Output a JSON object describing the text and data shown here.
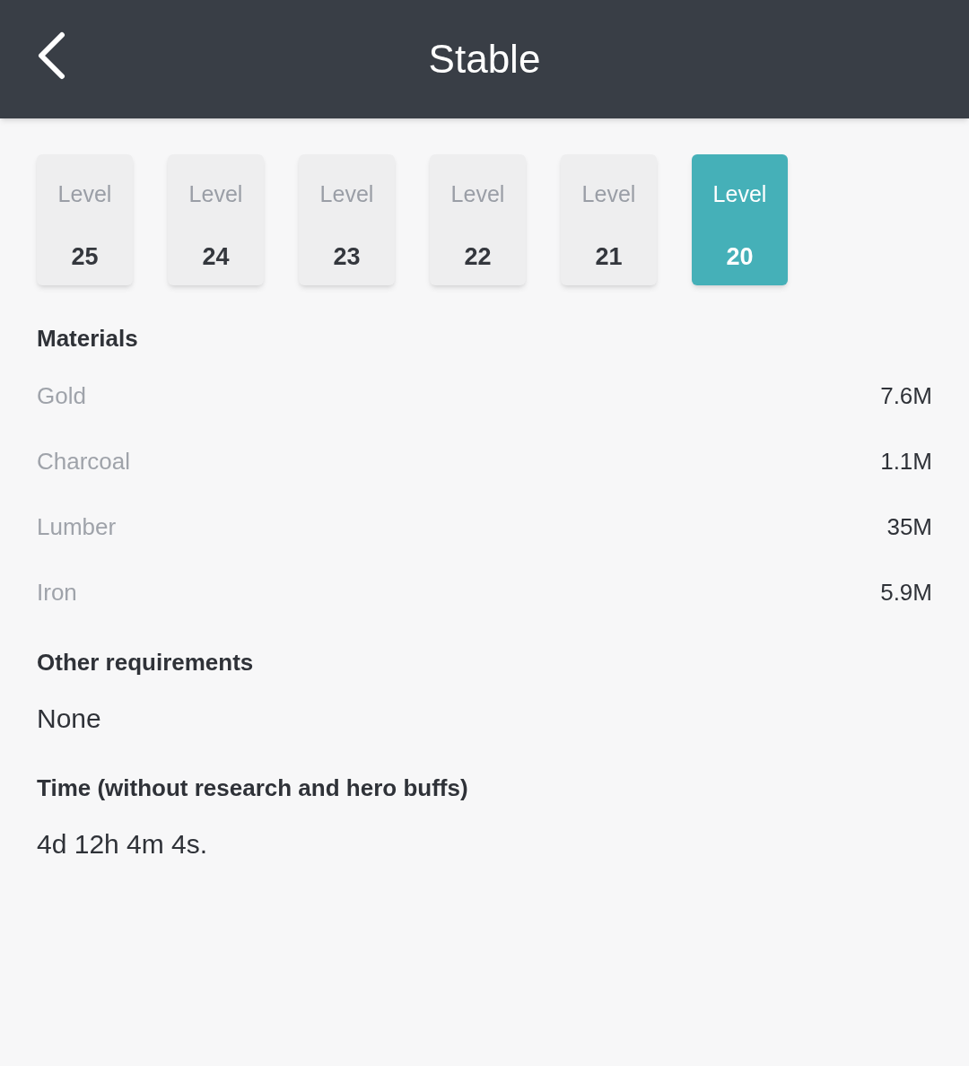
{
  "header": {
    "title": "Stable"
  },
  "levels": [
    {
      "label": "Level",
      "number": "25",
      "selected": false
    },
    {
      "label": "Level",
      "number": "24",
      "selected": false
    },
    {
      "label": "Level",
      "number": "23",
      "selected": false
    },
    {
      "label": "Level",
      "number": "22",
      "selected": false
    },
    {
      "label": "Level",
      "number": "21",
      "selected": false
    },
    {
      "label": "Level",
      "number": "20",
      "selected": true
    }
  ],
  "materials": {
    "heading": "Materials",
    "rows": [
      {
        "name": "Gold",
        "value": "7.6M"
      },
      {
        "name": "Charcoal",
        "value": "1.1M"
      },
      {
        "name": "Lumber",
        "value": "35M"
      },
      {
        "name": "Iron",
        "value": "5.9M"
      }
    ]
  },
  "other_requirements": {
    "heading": "Other requirements",
    "value": "None"
  },
  "time": {
    "heading": "Time (without research and hero buffs)",
    "value": "4d 12h 4m 4s."
  }
}
